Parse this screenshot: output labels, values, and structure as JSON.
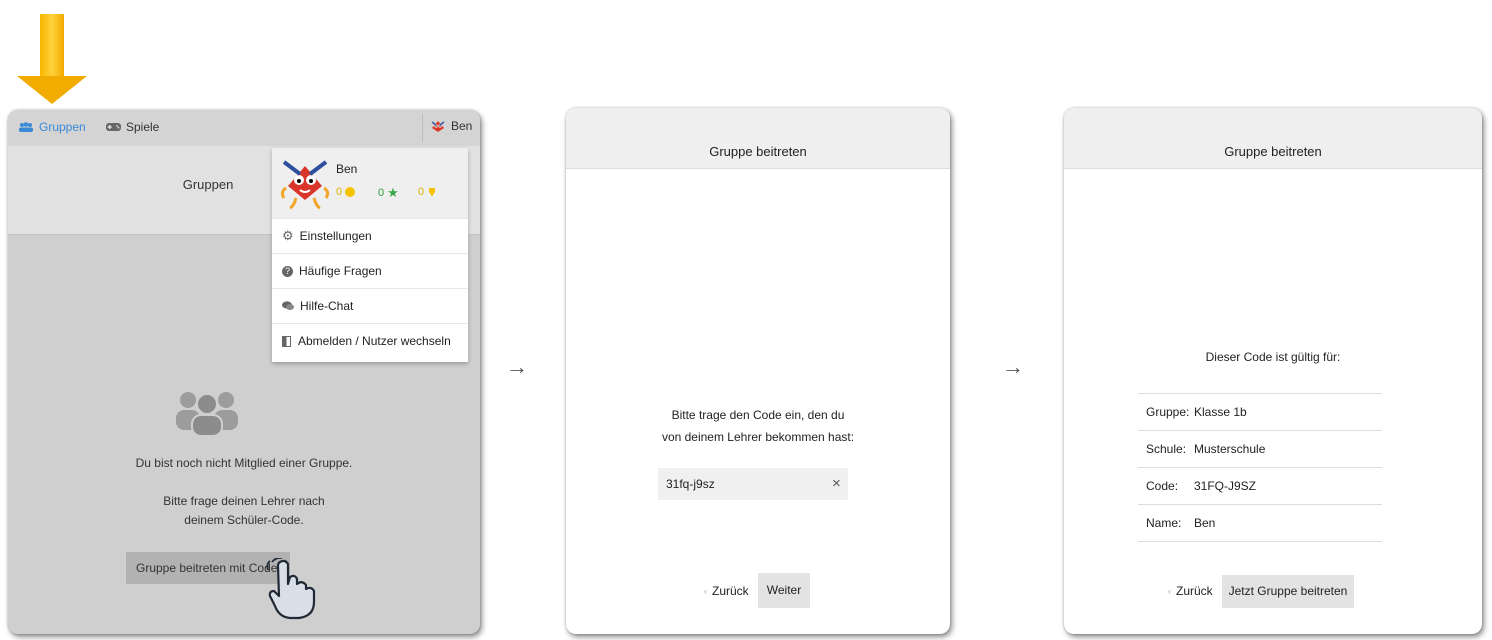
{
  "arrows": {
    "sep": "→"
  },
  "screen1": {
    "nav": {
      "groups": "Gruppen",
      "games": "Spiele",
      "user": "Ben"
    },
    "title": "Gruppen",
    "not_member": "Du bist noch nicht Mitglied einer Gruppe.",
    "ask_line1": "Bitte frage deinen Lehrer nach",
    "ask_line2": "deinem Schüler-Code.",
    "join_button": "Gruppe beitreten mit Code",
    "dropdown": {
      "name": "Ben",
      "coins": "0",
      "stars": "0",
      "trophies": "0",
      "items": [
        {
          "label": "Einstellungen",
          "icon": "gear-icon"
        },
        {
          "label": "Häufige Fragen",
          "icon": "question-icon"
        },
        {
          "label": "Hilfe-Chat",
          "icon": "chat-icon"
        },
        {
          "label": "Abmelden / Nutzer wechseln",
          "icon": "logout-icon"
        }
      ]
    }
  },
  "screen2": {
    "title": "Gruppe beitreten",
    "prompt_line1": "Bitte trage den Code ein, den du",
    "prompt_line2": "von deinem Lehrer bekommen hast:",
    "code_value": "31fq-j9sz",
    "clear": "×",
    "back": "Zurück",
    "next": "Weiter"
  },
  "screen3": {
    "title": "Gruppe beitreten",
    "valid_for": "Dieser Code ist gültig für:",
    "rows": [
      {
        "label": "Gruppe:",
        "value": "Klasse 1b"
      },
      {
        "label": "Schule:",
        "value": "Musterschule"
      },
      {
        "label": "Code:",
        "value": "31FQ-J9SZ"
      },
      {
        "label": "Name:",
        "value": "Ben"
      }
    ],
    "back": "Zurück",
    "join_now": "Jetzt Gruppe beitreten",
    "corner": "n"
  },
  "colors": {
    "accent": "#3a8ad6",
    "arrow": "#f5b400",
    "star": "#3aa84a",
    "coin": "#f5c200"
  }
}
